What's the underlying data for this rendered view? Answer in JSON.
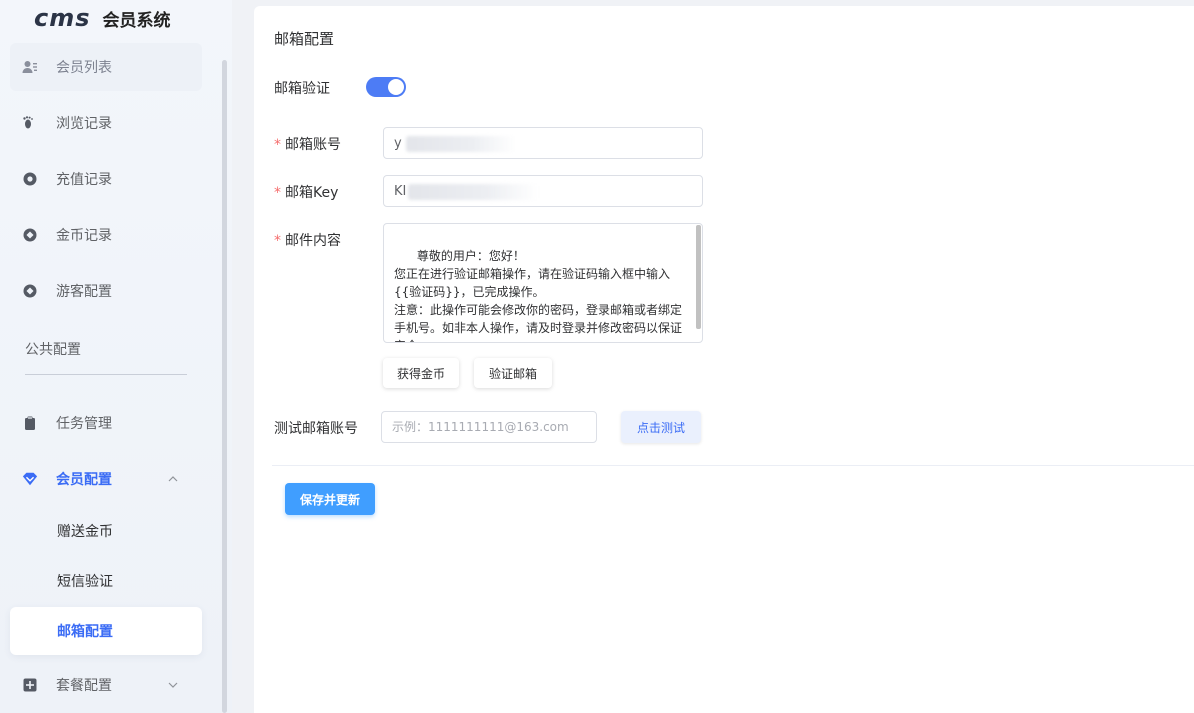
{
  "app": {
    "logo_mark": "cms",
    "title": "会员系统"
  },
  "sidebar": {
    "items_top": [
      {
        "label": "会员列表",
        "icon": "user-list-icon"
      },
      {
        "label": "浏览记录",
        "icon": "footprint-icon"
      },
      {
        "label": "充值记录",
        "icon": "recharge-icon"
      },
      {
        "label": "金币记录",
        "icon": "coin-icon"
      },
      {
        "label": "游客配置",
        "icon": "visitor-icon"
      }
    ],
    "group_label": "公共配置",
    "task": {
      "label": "任务管理",
      "icon": "clipboard-icon"
    },
    "member_config": {
      "label": "会员配置",
      "icon": "diamond-icon",
      "expanded": true,
      "children": [
        "赠送金币",
        "短信验证",
        "邮箱配置"
      ],
      "active_child": "邮箱配置"
    },
    "package": {
      "label": "套餐配置",
      "icon": "plus-square-icon",
      "expanded": false
    }
  },
  "form": {
    "title": "邮箱配置",
    "email_verify_label": "邮箱验证",
    "email_verify_enabled": true,
    "account_label": "邮箱账号",
    "account_value": "y",
    "key_label": "邮箱Key",
    "key_value": "KI",
    "content_label": "邮件内容",
    "content_value": "尊敬的用户：您好！\n您正在进行验证邮箱操作，请在验证码输入框中输入{{验证码}}，已完成操作。\n注意：此操作可能会修改你的密码，登录邮箱或者绑定手机号。如非本人操作，请及时登录并修改密码以保证安全。",
    "btn_get_coins": "获得金币",
    "btn_verify_email": "验证邮箱",
    "test_label": "测试邮箱账号",
    "test_placeholder": "示例：1111111111@163.com",
    "btn_test": "点击测试",
    "btn_save": "保存并更新"
  },
  "colors": {
    "accent": "#3b6cf5",
    "primary_button": "#409eff",
    "required": "#f56c6c"
  }
}
